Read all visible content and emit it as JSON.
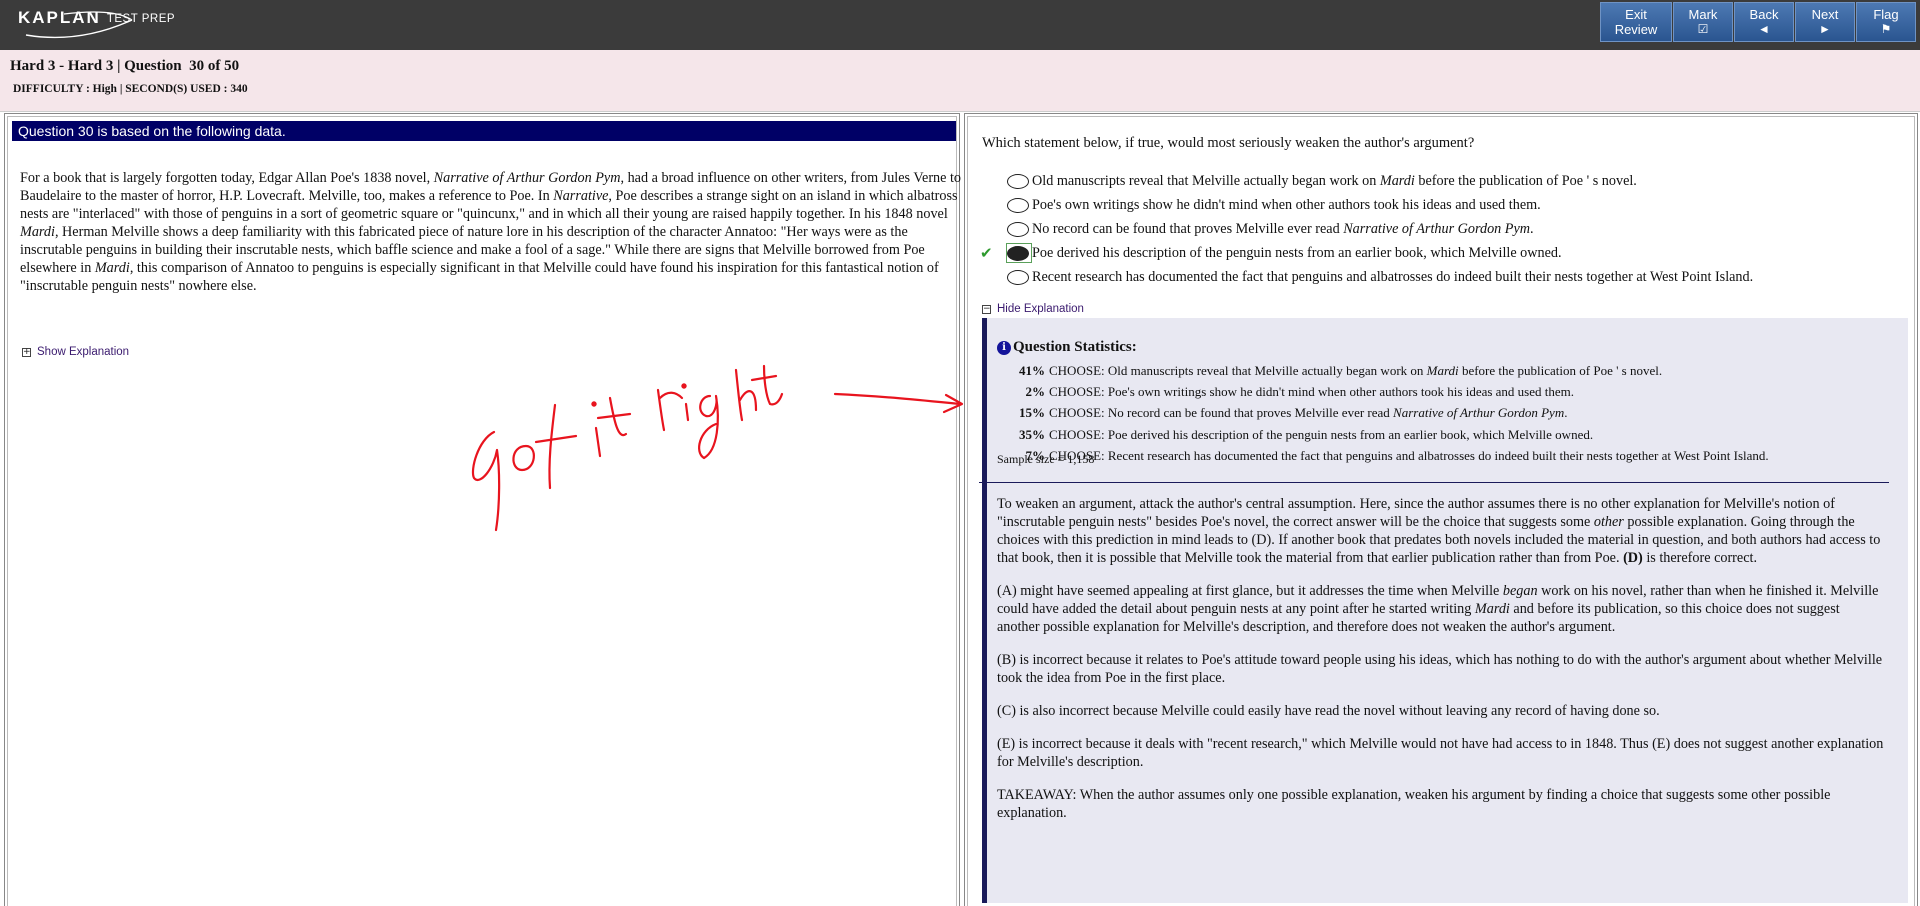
{
  "brand": {
    "name": "KAPLAN",
    "sub": "TEST PREP"
  },
  "nav": {
    "exit_review": {
      "line1": "Exit",
      "line2": "Review"
    },
    "mark": {
      "label": "Mark",
      "glyph": "☑"
    },
    "back": {
      "label": "Back",
      "glyph": "◄"
    },
    "next": {
      "label": "Next",
      "glyph": "►"
    },
    "flag": {
      "label": "Flag",
      "glyph": "⚑"
    }
  },
  "header": {
    "title": "Hard 3 - Hard 3 | Question  30 of 50",
    "difficulty": "DIFFICULTY : High | SECOND(S) USED : 340"
  },
  "passage": {
    "heading": "Question 30 is based on the following data.",
    "p1": "For a book that is largely forgotten today, Edgar Allan Poe's 1838 novel, ",
    "i1": "Narrative of Arthur Gordon Pym",
    "p2": ", had a broad influence on other writers, from Jules Verne to Baudelaire to the master of horror, H.P. Lovecraft. Melville, too, makes a reference to Poe. In ",
    "i2": "Narrative",
    "p3": ", Poe describes a strange sight on an island in which albatross nests are \"interlaced\" with those of penguins in a sort of geometric square or \"quincunx,\" and in which all their young are raised happily together. In his 1848 novel ",
    "i3": "Mardi",
    "p4": ", Herman Melville shows a deep familiarity with this fabricated piece of nature lore in his description of the character Annatoo: \"Her ways were as the inscrutable penguins in building their inscrutable nests, which baffle science and make a fool of a sage.\" While there are signs that Melville borrowed from Poe elsewhere in ",
    "i4": "Mardi",
    "p5": ", this comparison of Annatoo to penguins is especially significant in that Melville could have found his inspiration for this fantastical notion of \"inscrutable penguin nests\" nowhere else.",
    "show_explanation": "Show Explanation"
  },
  "annotation": {
    "text": "got it right"
  },
  "question": {
    "stem": "Which statement below, if true, would most seriously weaken the author's argument?",
    "choices": [
      {
        "a": "Old manuscripts reveal that Melville actually began work on ",
        "i": "Mardi",
        "b": " before the publication of Poe ' s novel."
      },
      {
        "a": "Poe's own writings show he didn't mind when other authors took his ideas and used them.",
        "i": "",
        "b": ""
      },
      {
        "a": "No record can be found that proves Melville ever read ",
        "i": "Narrative of Arthur Gordon Pym",
        "b": "."
      },
      {
        "a": "Poe derived his description of the penguin nests from an earlier book, which Melville owned.",
        "i": "",
        "b": ""
      },
      {
        "a": "Recent research has documented the fact that penguins and albatrosses do indeed built their nests together at West Point Island.",
        "i": "",
        "b": ""
      }
    ],
    "selected_index": 3,
    "correct_index": 3,
    "hide_explanation": "Hide Explanation"
  },
  "stats": {
    "title": "Question Statistics:",
    "choose_word": "CHOOSE:",
    "rows": [
      {
        "pct": "41%",
        "a": "Old manuscripts reveal that Melville actually began work on ",
        "i": "Mardi",
        "b": " before the publication of Poe ' s novel."
      },
      {
        "pct": "2%",
        "a": "Poe's own writings show he didn't mind when other authors took his ideas and used them.",
        "i": "",
        "b": ""
      },
      {
        "pct": "15%",
        "a": "No record can be found that proves Melville ever read ",
        "i": "Narrative of Arthur Gordon Pym",
        "b": "."
      },
      {
        "pct": "35%",
        "a": "Poe derived his description of the penguin nests from an earlier book, which Melville owned.",
        "i": "",
        "b": ""
      },
      {
        "pct": "7%",
        "a": "Recent research has documented the fact that penguins and albatrosses do indeed built their nests together at West Point Island.",
        "i": "",
        "b": ""
      }
    ],
    "sample": "Sample size = 1,158"
  },
  "explanation": {
    "e1a": "To weaken an argument, attack the author's central assumption. Here, since the author assumes there is no other explanation for Melville's notion of \"inscrutable penguin nests\" besides Poe's novel, the correct answer will be the choice that suggests some ",
    "e1i": "other",
    "e1b": " possible explanation. Going through the choices with this prediction in mind leads to (D). If another book that predates both novels included the material in question, and both authors had access to that book, then it is possible that Melville took the material from that earlier publication rather than from Poe. ",
    "e1bold": "(D)",
    "e1c": " is therefore correct.",
    "e2a": "(A) might have seemed appealing at first glance, but it addresses the time when Melville ",
    "e2i": "began",
    "e2b": " work on his novel, rather than when he finished it. Melville could have added the detail about penguin nests at any point after he started writing ",
    "e2i2": "Mardi",
    "e2c": " and before its publication, so this choice does not suggest another possible explanation for Melville's description, and therefore does not weaken the author's argument.",
    "e3": "(B) is incorrect because it relates to Poe's attitude toward people using his ideas, which has nothing to do with the author's argument about whether Melville took the idea from Poe in the first place.",
    "e4": "(C) is also incorrect because Melville could easily have read the novel without leaving any record of having done so.",
    "e5": "(E) is incorrect because it deals with \"recent research,\" which Melville would not have had access to in 1848. Thus (E) does not suggest another explanation for Melville's description.",
    "e6": "TAKEAWAY: When the author assumes only one possible explanation, weaken his argument by finding a choice that suggests some other possible explanation."
  },
  "colors": {
    "topbar": "#3b3b3b",
    "nav_button": "#2a5590",
    "header_bg": "#f5e6ea",
    "passage_head": "#000066",
    "annotation_ink": "#e8141e",
    "correct_check": "#2e9a2e"
  }
}
